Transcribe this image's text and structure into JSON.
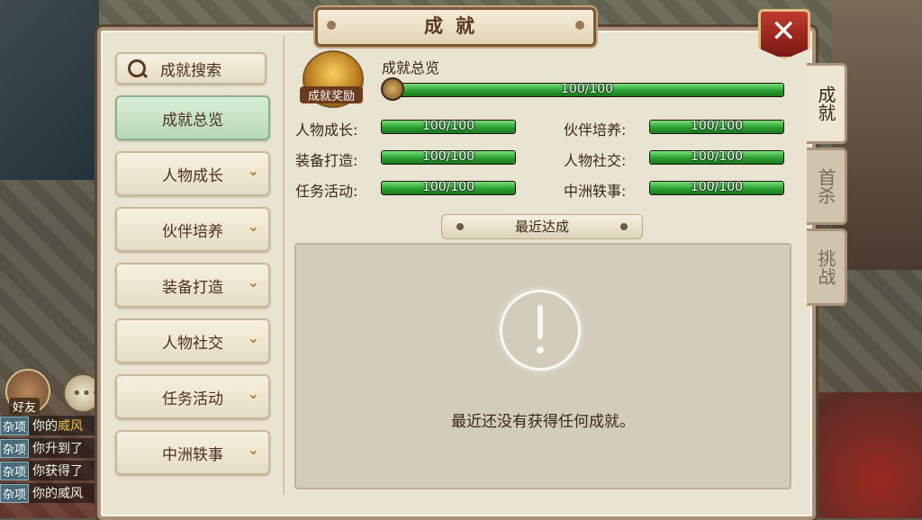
{
  "window": {
    "title": "成就"
  },
  "close_icon": "close-x-icon",
  "menu": {
    "search_label": "成就搜索",
    "items": [
      {
        "label": "成就总览",
        "active": true,
        "has_chevron": false
      },
      {
        "label": "人物成长",
        "active": false,
        "has_chevron": true
      },
      {
        "label": "伙伴培养",
        "active": false,
        "has_chevron": true
      },
      {
        "label": "装备打造",
        "active": false,
        "has_chevron": true
      },
      {
        "label": "人物社交",
        "active": false,
        "has_chevron": true
      },
      {
        "label": "任务活动",
        "active": false,
        "has_chevron": true
      },
      {
        "label": "中洲轶事",
        "active": false,
        "has_chevron": true
      }
    ]
  },
  "overview": {
    "chest_label": "成就奖励",
    "title": "成就总览",
    "progress": {
      "text": "100/100",
      "current": 100,
      "max": 100
    }
  },
  "stats": [
    {
      "label": "人物成长:",
      "text": "100/100",
      "current": 100,
      "max": 100
    },
    {
      "label": "伙伴培养:",
      "text": "100/100",
      "current": 100,
      "max": 100
    },
    {
      "label": "装备打造:",
      "text": "100/100",
      "current": 100,
      "max": 100
    },
    {
      "label": "人物社交:",
      "text": "100/100",
      "current": 100,
      "max": 100
    },
    {
      "label": "任务活动:",
      "text": "100/100",
      "current": 100,
      "max": 100
    },
    {
      "label": "中洲轶事:",
      "text": "100/100",
      "current": 100,
      "max": 100
    }
  ],
  "recent": {
    "header": "最近达成",
    "empty_text": "最近还没有获得任何成就。"
  },
  "tabs": [
    {
      "label": "成就",
      "active": true
    },
    {
      "label": "首杀",
      "active": false
    },
    {
      "label": "挑战",
      "active": false
    }
  ],
  "chat": {
    "friend_label": "好友",
    "lines": [
      {
        "tag": "杂项",
        "text": "你的",
        "highlight": "威风"
      },
      {
        "tag": "杂项",
        "text": "你升到了",
        "highlight": ""
      },
      {
        "tag": "杂项",
        "text": "你获得了",
        "highlight": ""
      },
      {
        "tag": "杂项",
        "text": "你的威风",
        "highlight": ""
      }
    ]
  }
}
